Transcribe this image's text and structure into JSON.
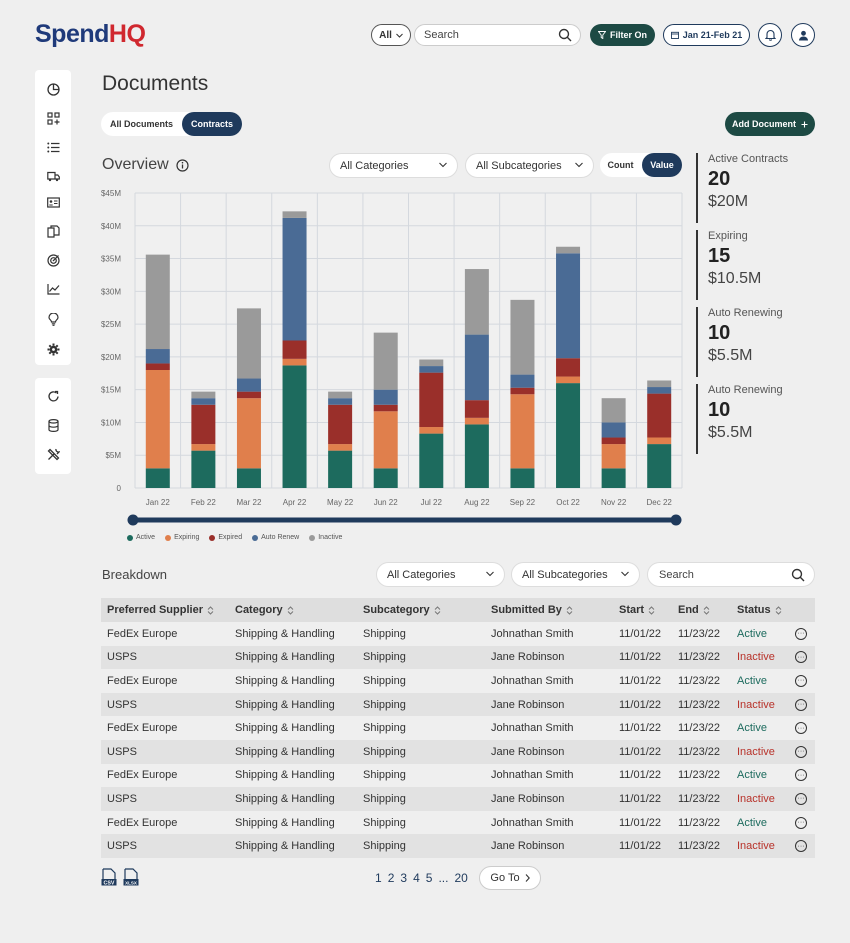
{
  "brand": {
    "part1": "Spend",
    "part2": "HQ"
  },
  "header": {
    "scope_select": "All",
    "search_placeholder": "Search",
    "filter_label": "Filter On",
    "date_label": "Jan 21-Feb 21",
    "icons": [
      "bell-icon",
      "user-icon"
    ]
  },
  "sidebar": {
    "group1": [
      "pie-chart-icon",
      "grid-plus-icon",
      "list-icon",
      "truck-icon",
      "id-card-icon",
      "documents-icon",
      "target-icon",
      "line-chart-icon",
      "lightbulb-icon",
      "gear-icon"
    ],
    "group2": [
      "refresh-icon",
      "database-icon",
      "tools-icon"
    ]
  },
  "page": {
    "title": "Documents",
    "tabs": [
      "All Documents",
      "Contracts"
    ],
    "active_tab": "Contracts",
    "add_label": "Add Document"
  },
  "overview": {
    "title": "Overview",
    "category_select": "All Categories",
    "subcategory_select": "All Subcategories",
    "toggle": [
      "Count",
      "Value"
    ],
    "toggle_active": "Value"
  },
  "stats": [
    {
      "label": "Active Contracts",
      "count": "20",
      "value": "$20M"
    },
    {
      "label": "Expiring",
      "count": "15",
      "value": "$10.5M"
    },
    {
      "label": "Auto Renewing",
      "count": "10",
      "value": "$5.5M"
    },
    {
      "label": "Auto Renewing",
      "count": "10",
      "value": "$5.5M"
    }
  ],
  "chart_data": {
    "type": "bar",
    "stacked": true,
    "categories": [
      "Jan 22",
      "Feb 22",
      "Mar 22",
      "Apr 22",
      "May 22",
      "Jun 22",
      "Jul 22",
      "Aug 22",
      "Sep 22",
      "Oct 22",
      "Nov 22",
      "Dec 22"
    ],
    "yticks": [
      "0",
      "$5M",
      "$10M",
      "$15M",
      "$20M",
      "$25M",
      "$30M",
      "$35M",
      "$40M",
      "$45M"
    ],
    "ylim": [
      0,
      45
    ],
    "grid": true,
    "legend_position": "bottom-left",
    "series": [
      {
        "name": "Active",
        "color": "#1d6b5e",
        "values": [
          3,
          5.7,
          3,
          18.7,
          5.7,
          3,
          8.3,
          9.7,
          3,
          16,
          3,
          6.7
        ]
      },
      {
        "name": "Expiring",
        "color": "#e07f4c",
        "values": [
          15,
          1,
          10.7,
          1,
          1,
          8.7,
          1,
          1,
          11.3,
          1,
          3.7,
          1
        ]
      },
      {
        "name": "Expired",
        "color": "#9a2f2a",
        "values": [
          1,
          6,
          1,
          2.8,
          6,
          1,
          8.3,
          2.7,
          1,
          2.8,
          1,
          6.7
        ]
      },
      {
        "name": "Auto Renew",
        "color": "#4a6b95",
        "values": [
          2.2,
          1,
          2,
          18.7,
          1,
          2.3,
          1,
          10,
          2,
          16,
          2.3,
          1
        ]
      },
      {
        "name": "Inactive",
        "color": "#9a9a9a",
        "values": [
          14.4,
          1,
          10.7,
          1,
          1,
          8.7,
          1,
          10,
          11.4,
          1,
          3.7,
          1
        ]
      }
    ]
  },
  "breakdown": {
    "title": "Breakdown",
    "category_select": "All Categories",
    "subcategory_select": "All Subcategories",
    "search_placeholder": "Search",
    "columns": [
      "Preferred Supplier",
      "Category",
      "Subcategory",
      "Submitted By",
      "Start",
      "End",
      "Status"
    ],
    "rows": [
      [
        "FedEx Europe",
        "Shipping & Handling",
        "Shipping",
        "Johnathan Smith",
        "11/01/22",
        "11/23/22",
        "Active"
      ],
      [
        "USPS",
        "Shipping & Handling",
        "Shipping",
        "Jane Robinson",
        "11/01/22",
        "11/23/22",
        "Inactive"
      ],
      [
        "FedEx Europe",
        "Shipping & Handling",
        "Shipping",
        "Johnathan Smith",
        "11/01/22",
        "11/23/22",
        "Active"
      ],
      [
        "USPS",
        "Shipping & Handling",
        "Shipping",
        "Jane Robinson",
        "11/01/22",
        "11/23/22",
        "Inactive"
      ],
      [
        "FedEx Europe",
        "Shipping & Handling",
        "Shipping",
        "Johnathan Smith",
        "11/01/22",
        "11/23/22",
        "Active"
      ],
      [
        "USPS",
        "Shipping & Handling",
        "Shipping",
        "Jane Robinson",
        "11/01/22",
        "11/23/22",
        "Inactive"
      ],
      [
        "FedEx Europe",
        "Shipping & Handling",
        "Shipping",
        "Johnathan Smith",
        "11/01/22",
        "11/23/22",
        "Active"
      ],
      [
        "USPS",
        "Shipping & Handling",
        "Shipping",
        "Jane Robinson",
        "11/01/22",
        "11/23/22",
        "Inactive"
      ],
      [
        "FedEx Europe",
        "Shipping & Handling",
        "Shipping",
        "Johnathan Smith",
        "11/01/22",
        "11/23/22",
        "Active"
      ],
      [
        "USPS",
        "Shipping & Handling",
        "Shipping",
        "Jane Robinson",
        "11/01/22",
        "11/23/22",
        "Inactive"
      ]
    ],
    "status_colors": {
      "Active": "#1d6b5e",
      "Inactive": "#b8322a"
    }
  },
  "footer": {
    "export": [
      "CSV",
      "XLSX"
    ],
    "pages": [
      "1",
      "2",
      "3",
      "4",
      "5",
      "...",
      "20"
    ],
    "goto_label": "Go To"
  }
}
